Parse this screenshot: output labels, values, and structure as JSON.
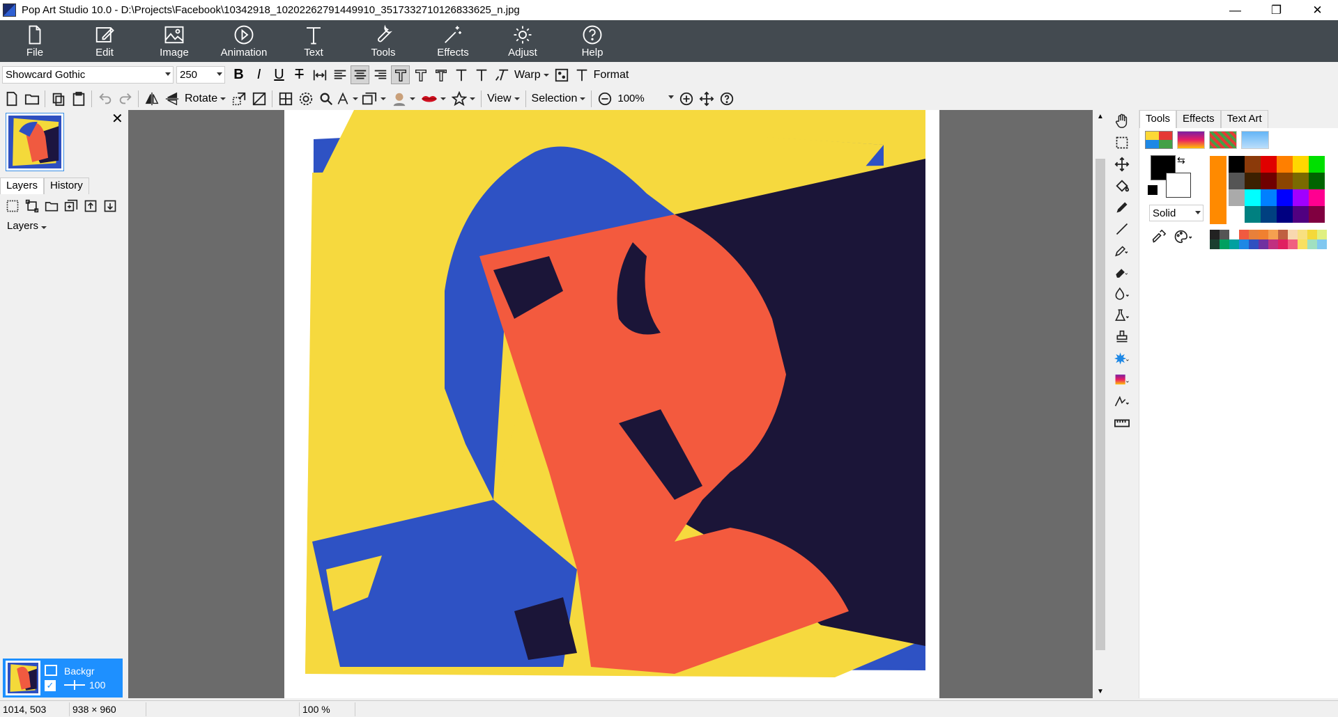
{
  "window": {
    "title": "Pop Art Studio 10.0 - D:\\Projects\\Facebook\\10342918_10202262791449910_3517332710126833625_n.jpg",
    "minimize": "—",
    "maximize": "❐",
    "close": "✕"
  },
  "ribbon": [
    {
      "label": "File",
      "icon": "file-icon"
    },
    {
      "label": "Edit",
      "icon": "edit-icon"
    },
    {
      "label": "Image",
      "icon": "image-icon"
    },
    {
      "label": "Animation",
      "icon": "play-icon"
    },
    {
      "label": "Text",
      "icon": "text-icon"
    },
    {
      "label": "Tools",
      "icon": "wrench-icon"
    },
    {
      "label": "Effects",
      "icon": "wand-icon"
    },
    {
      "label": "Adjust",
      "icon": "sun-icon"
    },
    {
      "label": "Help",
      "icon": "help-icon"
    }
  ],
  "text_toolbar": {
    "font": "Showcard Gothic",
    "size": "250",
    "bold": "B",
    "italic": "I",
    "underline": "U",
    "strike": "T",
    "warp": "Warp",
    "format": "Format"
  },
  "main_toolbar": {
    "rotate": "Rotate",
    "view": "View",
    "selection": "Selection",
    "zoom": "100%"
  },
  "left_panel": {
    "tabs": [
      "Layers",
      "History"
    ],
    "layers_dropdown": "Layers",
    "layer": {
      "name": "Backgr",
      "opacity": "100"
    }
  },
  "right_panel": {
    "tabs": [
      "Tools",
      "Effects",
      "Text Art"
    ],
    "fill_mode": "Solid",
    "colors": {
      "foreground": "#000000",
      "background": "#ffffff",
      "accent": "#ff8a00"
    }
  },
  "status": {
    "coords": "1014, 503",
    "size": "938 × 960",
    "zoom": "100 %"
  }
}
